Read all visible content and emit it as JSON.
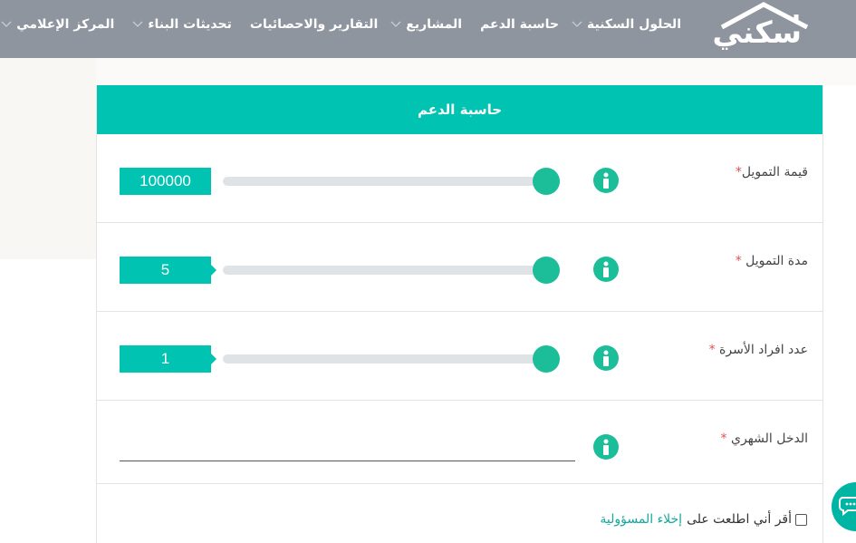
{
  "brand": {
    "logo_text": "سكني"
  },
  "nav": {
    "items": [
      {
        "label": "الحلول السكنية",
        "dropdown": true
      },
      {
        "label": "حاسبة الدعم",
        "dropdown": false
      },
      {
        "label": "المشاريع",
        "dropdown": true
      },
      {
        "label": "التقارير والاحصائيات",
        "dropdown": false
      },
      {
        "label": "تحديثات البناء",
        "dropdown": true
      },
      {
        "label": "المركز الإعلامي",
        "dropdown": true
      }
    ]
  },
  "calculator": {
    "title": "حاسبة الدعم",
    "fields": [
      {
        "label": "قيمة التمويل",
        "required_mark": "*",
        "value": "100000",
        "slider_fraction": 1.0
      },
      {
        "label": "مدة التمويل ",
        "required_mark": "*",
        "value": "5",
        "slider_fraction": 1.0
      },
      {
        "label": "عدد افراد الأسرة ",
        "required_mark": "*",
        "value": "1",
        "slider_fraction": 1.0
      },
      {
        "label": "الدخل الشهري ",
        "required_mark": "*",
        "value": "",
        "placeholder": ""
      }
    ],
    "consent": {
      "text": "أقر أني اطلعت على",
      "link_text": "إخلاء المسؤولية",
      "checked": false
    }
  },
  "colors": {
    "navbar": "#8e959e",
    "accent": "#00c3b1",
    "slider_thumb": "#1cbe9a",
    "link": "#13a89e",
    "required": "#e05050"
  },
  "icons": {
    "info": "info-icon",
    "chevron": "chevron-down-icon",
    "chat": "chat-icon"
  }
}
